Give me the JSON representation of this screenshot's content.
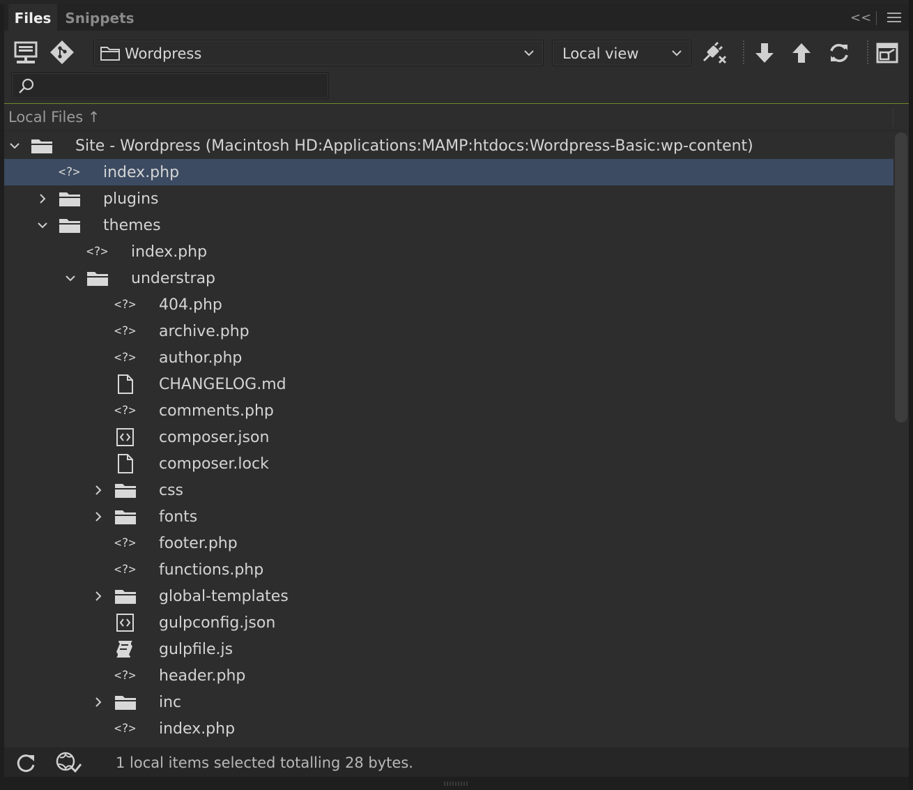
{
  "tabs": {
    "files": "Files",
    "snippets": "Snippets"
  },
  "toolbar": {
    "site_select": "Wordpress",
    "view_select": "Local view",
    "collapse_glyph": "<<"
  },
  "search": {
    "placeholder": ""
  },
  "panel": {
    "header_title": "Local Files",
    "sort_glyph": "↑"
  },
  "tree": [
    {
      "name": "Site - Wordpress (Macintosh HD:Applications:MAMP:htdocs:Wordpress-Basic:wp-content)",
      "level": 0,
      "icon": "folder-icon",
      "expander": "expanded"
    },
    {
      "name": "index.php",
      "level": 1,
      "icon": "php-file-icon",
      "expander": "none",
      "selected": true
    },
    {
      "name": "plugins",
      "level": 1,
      "icon": "folder-icon",
      "expander": "collapsed"
    },
    {
      "name": "themes",
      "level": 1,
      "icon": "folder-icon",
      "expander": "expanded"
    },
    {
      "name": "index.php",
      "level": 2,
      "icon": "php-file-icon",
      "expander": "none"
    },
    {
      "name": "understrap",
      "level": 2,
      "icon": "folder-icon",
      "expander": "expanded"
    },
    {
      "name": "404.php",
      "level": 3,
      "icon": "php-file-icon",
      "expander": "none"
    },
    {
      "name": "archive.php",
      "level": 3,
      "icon": "php-file-icon",
      "expander": "none"
    },
    {
      "name": "author.php",
      "level": 3,
      "icon": "php-file-icon",
      "expander": "none"
    },
    {
      "name": "CHANGELOG.md",
      "level": 3,
      "icon": "document-icon",
      "expander": "none"
    },
    {
      "name": "comments.php",
      "level": 3,
      "icon": "php-file-icon",
      "expander": "none"
    },
    {
      "name": "composer.json",
      "level": 3,
      "icon": "json-file-icon",
      "expander": "none"
    },
    {
      "name": "composer.lock",
      "level": 3,
      "icon": "document-icon",
      "expander": "none"
    },
    {
      "name": "css",
      "level": 3,
      "icon": "folder-icon",
      "expander": "collapsed"
    },
    {
      "name": "fonts",
      "level": 3,
      "icon": "folder-icon",
      "expander": "collapsed"
    },
    {
      "name": "footer.php",
      "level": 3,
      "icon": "php-file-icon",
      "expander": "none"
    },
    {
      "name": "functions.php",
      "level": 3,
      "icon": "php-file-icon",
      "expander": "none"
    },
    {
      "name": "global-templates",
      "level": 3,
      "icon": "folder-icon",
      "expander": "collapsed"
    },
    {
      "name": "gulpconfig.json",
      "level": 3,
      "icon": "json-file-icon",
      "expander": "none"
    },
    {
      "name": "gulpfile.js",
      "level": 3,
      "icon": "script-file-icon",
      "expander": "none"
    },
    {
      "name": "header.php",
      "level": 3,
      "icon": "php-file-icon",
      "expander": "none"
    },
    {
      "name": "inc",
      "level": 3,
      "icon": "folder-icon",
      "expander": "collapsed"
    },
    {
      "name": "index.php",
      "level": 3,
      "icon": "php-file-icon",
      "expander": "none"
    }
  ],
  "status": {
    "text": "1 local items selected totalling 28 bytes."
  },
  "colors": {
    "selection": "#3c4b61",
    "panel": "#2d2d2d",
    "accent_line": "#6f8a2a"
  }
}
